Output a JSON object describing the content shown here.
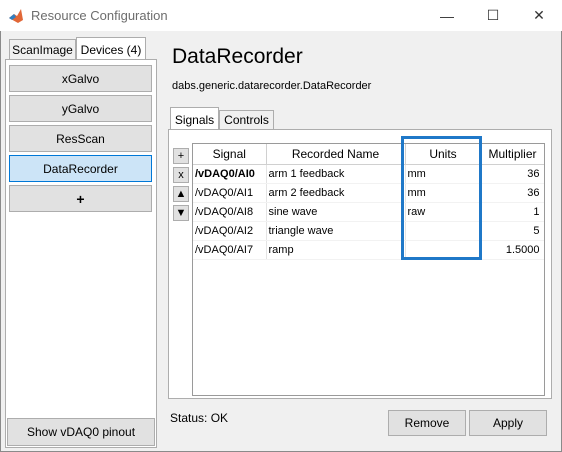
{
  "window": {
    "title": "Resource Configuration",
    "minimize": "—",
    "maximize": "☐",
    "close": "✕"
  },
  "left_tabs": [
    {
      "label": "ScanImage"
    },
    {
      "label": "Devices (4)"
    }
  ],
  "devices": [
    {
      "label": "xGalvo"
    },
    {
      "label": "yGalvo"
    },
    {
      "label": "ResScan"
    },
    {
      "label": "DataRecorder"
    },
    {
      "label": "+"
    }
  ],
  "pinout_button": "Show vDAQ0 pinout",
  "device": {
    "title": "DataRecorder",
    "class_name": "dabs.generic.datarecorder.DataRecorder"
  },
  "inner_tabs": [
    {
      "label": "Signals"
    },
    {
      "label": "Controls"
    }
  ],
  "row_buttons": {
    "add": "+",
    "remove": "x",
    "up": "▲",
    "down": "▼"
  },
  "table": {
    "headers": [
      "Signal",
      "Recorded Name",
      "Units",
      "Multiplier"
    ],
    "rows": [
      [
        "/vDAQ0/AI0",
        "arm 1 feedback",
        "mm",
        "36"
      ],
      [
        "/vDAQ0/AI1",
        "arm 2 feedback",
        "mm",
        "36"
      ],
      [
        "/vDAQ0/AI8",
        "sine wave",
        "raw",
        "1"
      ],
      [
        "/vDAQ0/AI2",
        "triangle wave",
        "",
        "5"
      ],
      [
        "/vDAQ0/AI7",
        "ramp",
        "",
        "1.5000"
      ]
    ]
  },
  "status": "Status: OK",
  "actions": {
    "remove": "Remove",
    "apply": "Apply"
  },
  "colors": {
    "highlight": "#1f78c8",
    "selected_bg": "#cce4f7"
  }
}
